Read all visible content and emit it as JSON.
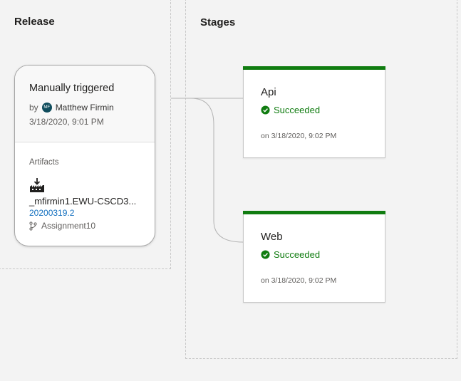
{
  "release": {
    "title": "Release",
    "trigger": "Manually triggered",
    "by_prefix": "by",
    "avatar_initials": "MF",
    "user": "Matthew Firmin",
    "date": "3/18/2020, 9:01 PM",
    "artifacts_label": "Artifacts",
    "artifact_icon": "build-artifact-icon",
    "artifact_name": "_mfirmin1.EWU-CSCD3...",
    "artifact_version": "20200319.2",
    "branch_icon": "branch-icon",
    "branch": "Assignment10"
  },
  "stages": {
    "title": "Stages",
    "items": [
      {
        "name": "Api",
        "status": "Succeeded",
        "status_icon": "check-circle-icon",
        "time": "on 3/18/2020, 9:02 PM",
        "color": "#107c10"
      },
      {
        "name": "Web",
        "status": "Succeeded",
        "status_icon": "check-circle-icon",
        "time": "on 3/18/2020, 9:02 PM",
        "color": "#107c10"
      }
    ]
  }
}
